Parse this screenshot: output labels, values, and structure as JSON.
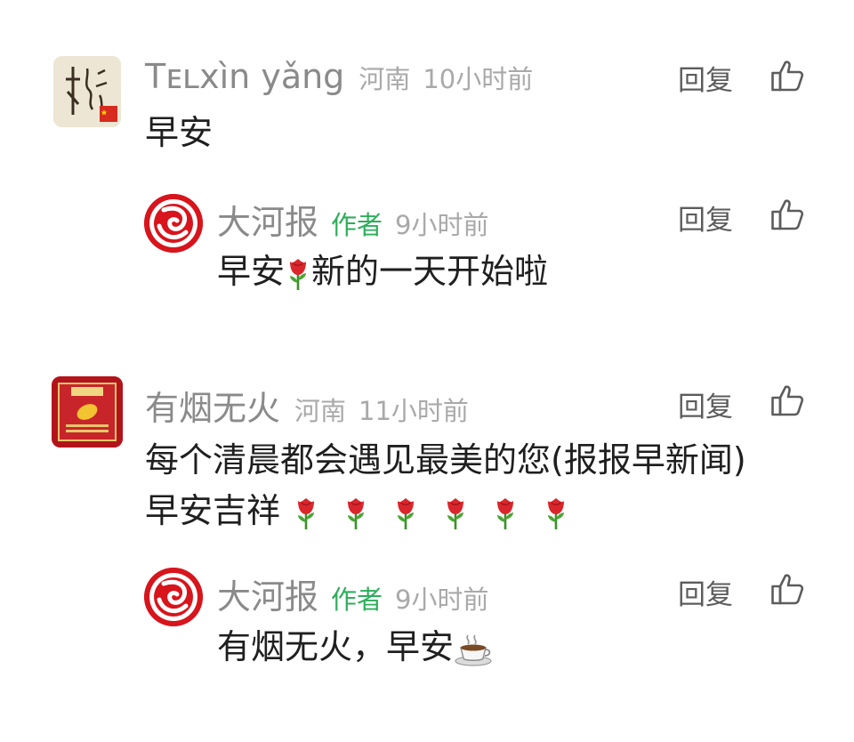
{
  "actions": {
    "reply": "回复"
  },
  "comments": [
    {
      "name": "Tᴇʟxìn yǎng",
      "location": "河南",
      "time": "10小时前",
      "text": "早安",
      "reply": {
        "name": "大河报",
        "tag": "作者",
        "time": "9小时前",
        "text_before": "早安",
        "text_after": "新的一天开始啦"
      }
    },
    {
      "name": "有烟无火",
      "location": "河南",
      "time": "11小时前",
      "line1": "每个清晨都会遇见最美的您(报报早新闻)",
      "line2": "早安吉祥",
      "reply": {
        "name": "大河报",
        "tag": "作者",
        "time": "9小时前",
        "text": "有烟无火，早安"
      }
    }
  ],
  "colors": {
    "author_tag": "#2cae5a",
    "brand_red": "#d8141c"
  }
}
